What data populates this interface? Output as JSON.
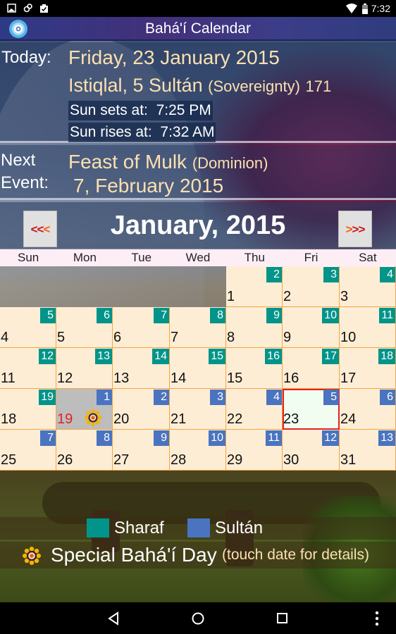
{
  "status_bar": {
    "time": "7:32",
    "icons": [
      "image-icon",
      "sync-icon",
      "clipboard-check-icon",
      "wifi-icon",
      "battery-icon"
    ]
  },
  "app": {
    "title": "Bahá'í Calendar"
  },
  "today": {
    "label": "Today:",
    "gregorian_date": "Friday, 23 January 2015",
    "bahai_date_main": "Istiqlal, 5 Sultán",
    "bahai_month_meaning": "(Sovereignty)",
    "bahai_year": "171",
    "sunset_label": "Sun sets at:",
    "sunset_time": "7:25 PM",
    "sunrise_label": "Sun rises at:",
    "sunrise_time": "7:32 AM"
  },
  "next_event": {
    "label_line1": "Next",
    "label_line2": "Event:",
    "name": "Feast of Mulk",
    "meaning": "(Dominion)",
    "date": "7, February 2015"
  },
  "month_nav": {
    "prev_label_a": "<<",
    "prev_label_b": "<",
    "next_label_a": ">",
    "next_label_b": ">>",
    "title": "January, 2015"
  },
  "weekdays": [
    "Sun",
    "Mon",
    "Tue",
    "Wed",
    "Thu",
    "Fri",
    "Sat"
  ],
  "calendar": {
    "first_weekday_index": 4,
    "selected_day": 23,
    "days": [
      {
        "g": "1",
        "b": "2",
        "m": "sharaf"
      },
      {
        "g": "2",
        "b": "3",
        "m": "sharaf"
      },
      {
        "g": "3",
        "b": "4",
        "m": "sharaf"
      },
      {
        "g": "4",
        "b": "5",
        "m": "sharaf"
      },
      {
        "g": "5",
        "b": "6",
        "m": "sharaf"
      },
      {
        "g": "6",
        "b": "7",
        "m": "sharaf"
      },
      {
        "g": "7",
        "b": "8",
        "m": "sharaf"
      },
      {
        "g": "8",
        "b": "9",
        "m": "sharaf"
      },
      {
        "g": "9",
        "b": "10",
        "m": "sharaf"
      },
      {
        "g": "10",
        "b": "11",
        "m": "sharaf"
      },
      {
        "g": "11",
        "b": "12",
        "m": "sharaf"
      },
      {
        "g": "12",
        "b": "13",
        "m": "sharaf"
      },
      {
        "g": "13",
        "b": "14",
        "m": "sharaf"
      },
      {
        "g": "14",
        "b": "15",
        "m": "sharaf"
      },
      {
        "g": "15",
        "b": "16",
        "m": "sharaf"
      },
      {
        "g": "16",
        "b": "17",
        "m": "sharaf"
      },
      {
        "g": "17",
        "b": "18",
        "m": "sharaf"
      },
      {
        "g": "18",
        "b": "19",
        "m": "sharaf"
      },
      {
        "g": "19",
        "b": "1",
        "m": "sultan",
        "special": true
      },
      {
        "g": "20",
        "b": "2",
        "m": "sultan"
      },
      {
        "g": "21",
        "b": "3",
        "m": "sultan"
      },
      {
        "g": "22",
        "b": "4",
        "m": "sultan"
      },
      {
        "g": "23",
        "b": "5",
        "m": "sultan",
        "today": true
      },
      {
        "g": "24",
        "b": "6",
        "m": "sultan"
      },
      {
        "g": "25",
        "b": "7",
        "m": "sultan"
      },
      {
        "g": "26",
        "b": "8",
        "m": "sultan"
      },
      {
        "g": "27",
        "b": "9",
        "m": "sultan"
      },
      {
        "g": "28",
        "b": "10",
        "m": "sultan"
      },
      {
        "g": "29",
        "b": "11",
        "m": "sultan"
      },
      {
        "g": "30",
        "b": "12",
        "m": "sultan"
      },
      {
        "g": "31",
        "b": "13",
        "m": "sultan"
      }
    ]
  },
  "legend": {
    "items": [
      {
        "label": "Sharaf",
        "color": "#00948a"
      },
      {
        "label": "Sultán",
        "color": "#4a74c0"
      }
    ],
    "special_label": "Special Bahá'í Day",
    "special_hint": "(touch date for details)"
  },
  "colors": {
    "sharaf": "#00948a",
    "sultan": "#4a74c0",
    "today_border": "#e52222",
    "special_day_text": "#e82020",
    "cell_bg": "#feedd5",
    "gold_text": "#fbe0b0"
  }
}
